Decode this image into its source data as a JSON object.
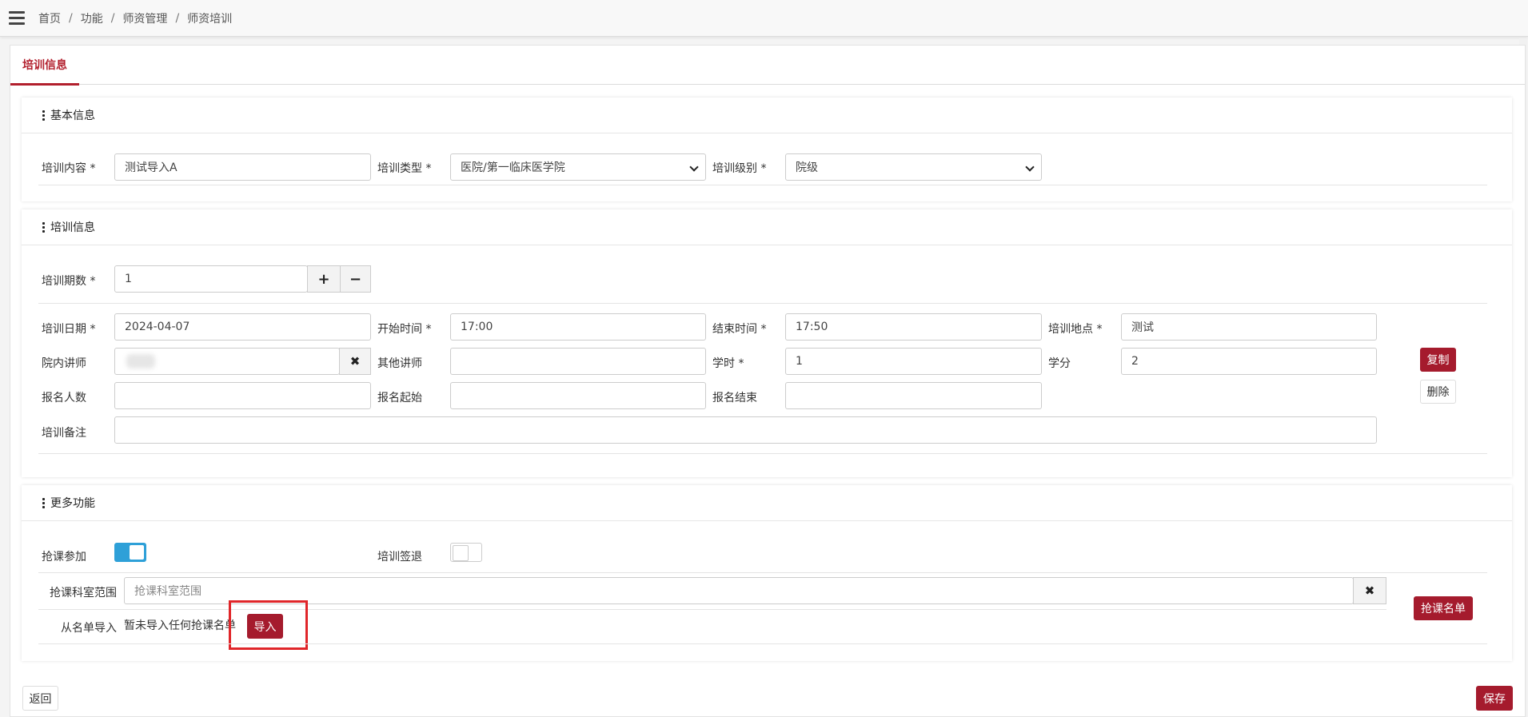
{
  "breadcrumb": [
    "首页",
    "功能",
    "师资管理",
    "师资培训"
  ],
  "tabs": [
    {
      "label": "培训信息"
    }
  ],
  "basic": {
    "title": "基本信息",
    "content_label": "培训内容 *",
    "content_value": "测试导入A",
    "type_label": "培训类型 *",
    "type_value": "医院/第一临床医学院",
    "level_label": "培训级别 *",
    "level_value": "院级"
  },
  "train": {
    "title": "培训信息",
    "periods_label": "培训期数 *",
    "periods_value": "1",
    "date_label": "培训日期 *",
    "date_value": "2024-04-07",
    "start_label": "开始时间 *",
    "start_value": "17:00",
    "end_label": "结束时间 *",
    "end_value": "17:50",
    "location_label": "培训地点 *",
    "location_value": "测试",
    "inner_lecturer_label": "院内讲师",
    "other_lecturer_label": "其他讲师",
    "hours_label": "学时 *",
    "hours_value": "1",
    "credit_label": "学分",
    "credit_value": "2",
    "enroll_count_label": "报名人数",
    "enroll_start_label": "报名起始",
    "enroll_end_label": "报名结束",
    "remark_label": "培训备注",
    "copy_button": "复制",
    "delete_button": "删除"
  },
  "more": {
    "title": "更多功能",
    "grab_label": "抢课参加",
    "signout_label": "培训签退",
    "scope_label": "抢课科室范围",
    "scope_placeholder": "抢课科室范围",
    "import_label": "从名单导入",
    "import_status": "暂未导入任何抢课名单",
    "import_button": "导入",
    "grab_list_button": "抢课名单"
  },
  "footer": {
    "back_button": "返回",
    "save_button": "保存"
  },
  "colors": {
    "accent": "#a51b2d",
    "toggle_on": "#2ea0d8",
    "highlight": "#e0262a"
  }
}
